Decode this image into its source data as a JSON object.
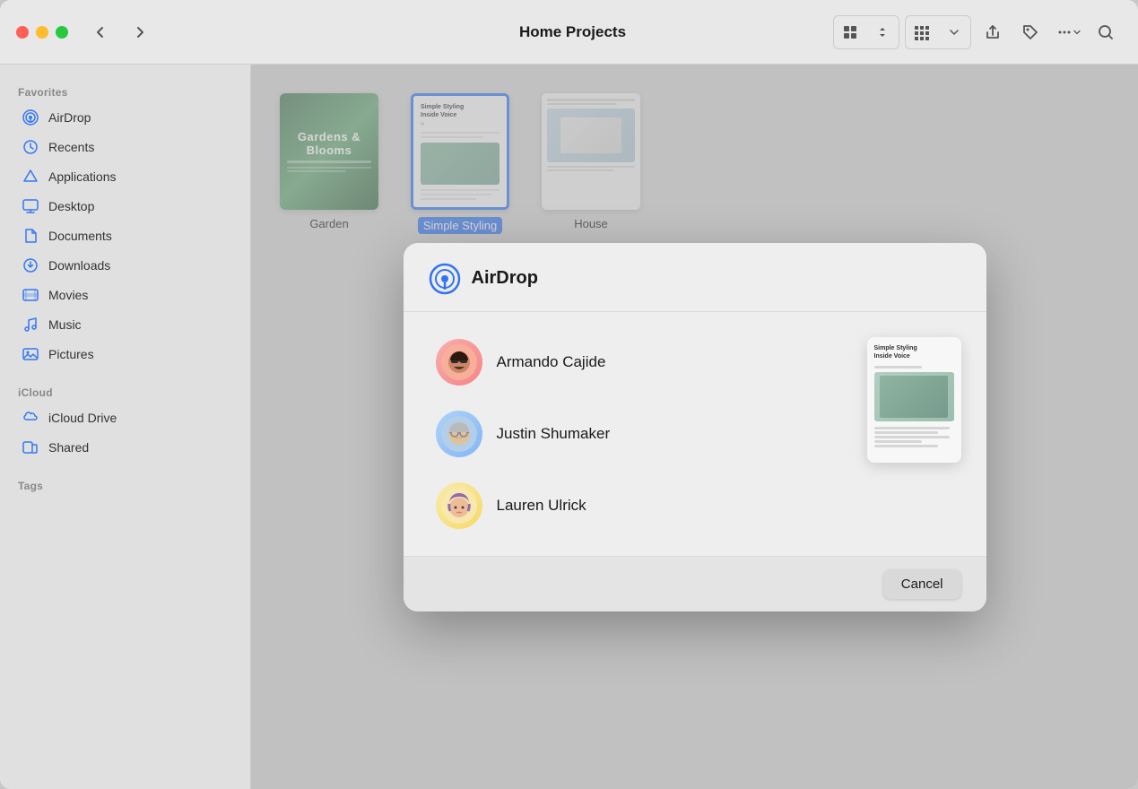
{
  "window": {
    "title": "Home Projects"
  },
  "traffic_lights": {
    "close": "close",
    "minimize": "minimize",
    "maximize": "maximize"
  },
  "sidebar": {
    "favorites_label": "Favorites",
    "items": [
      {
        "id": "airdrop",
        "label": "AirDrop",
        "icon": "airdrop"
      },
      {
        "id": "recents",
        "label": "Recents",
        "icon": "recents"
      },
      {
        "id": "applications",
        "label": "Applications",
        "icon": "applications"
      },
      {
        "id": "desktop",
        "label": "Desktop",
        "icon": "desktop"
      },
      {
        "id": "documents",
        "label": "Documents",
        "icon": "documents"
      },
      {
        "id": "downloads",
        "label": "Downloads",
        "icon": "downloads"
      },
      {
        "id": "movies",
        "label": "Movies",
        "icon": "movies"
      },
      {
        "id": "music",
        "label": "Music",
        "icon": "music"
      },
      {
        "id": "pictures",
        "label": "Pictures",
        "icon": "pictures"
      }
    ],
    "icloud_label": "iCloud",
    "icloud_items": [
      {
        "id": "icloud-drive",
        "label": "iCloud Drive",
        "icon": "icloud"
      },
      {
        "id": "shared",
        "label": "Shared",
        "icon": "shared"
      }
    ],
    "tags_label": "Tags"
  },
  "content": {
    "files": [
      {
        "id": "garden",
        "label": "Garden",
        "selected": false
      },
      {
        "id": "simple-styling",
        "label": "Simple Styling",
        "selected": true
      },
      {
        "id": "house",
        "label": "House",
        "selected": false
      }
    ]
  },
  "airdrop_modal": {
    "title": "AirDrop",
    "contacts": [
      {
        "id": "armando",
        "name": "Armando Cajide",
        "emoji": "🧔"
      },
      {
        "id": "justin",
        "name": "Justin Shumaker",
        "emoji": "🧓"
      },
      {
        "id": "lauren",
        "name": "Lauren Ulrick",
        "emoji": "👩‍🦱"
      }
    ],
    "document_preview": {
      "title_line1": "Simple Styling",
      "title_line2": "Inside Voice"
    },
    "cancel_label": "Cancel"
  }
}
